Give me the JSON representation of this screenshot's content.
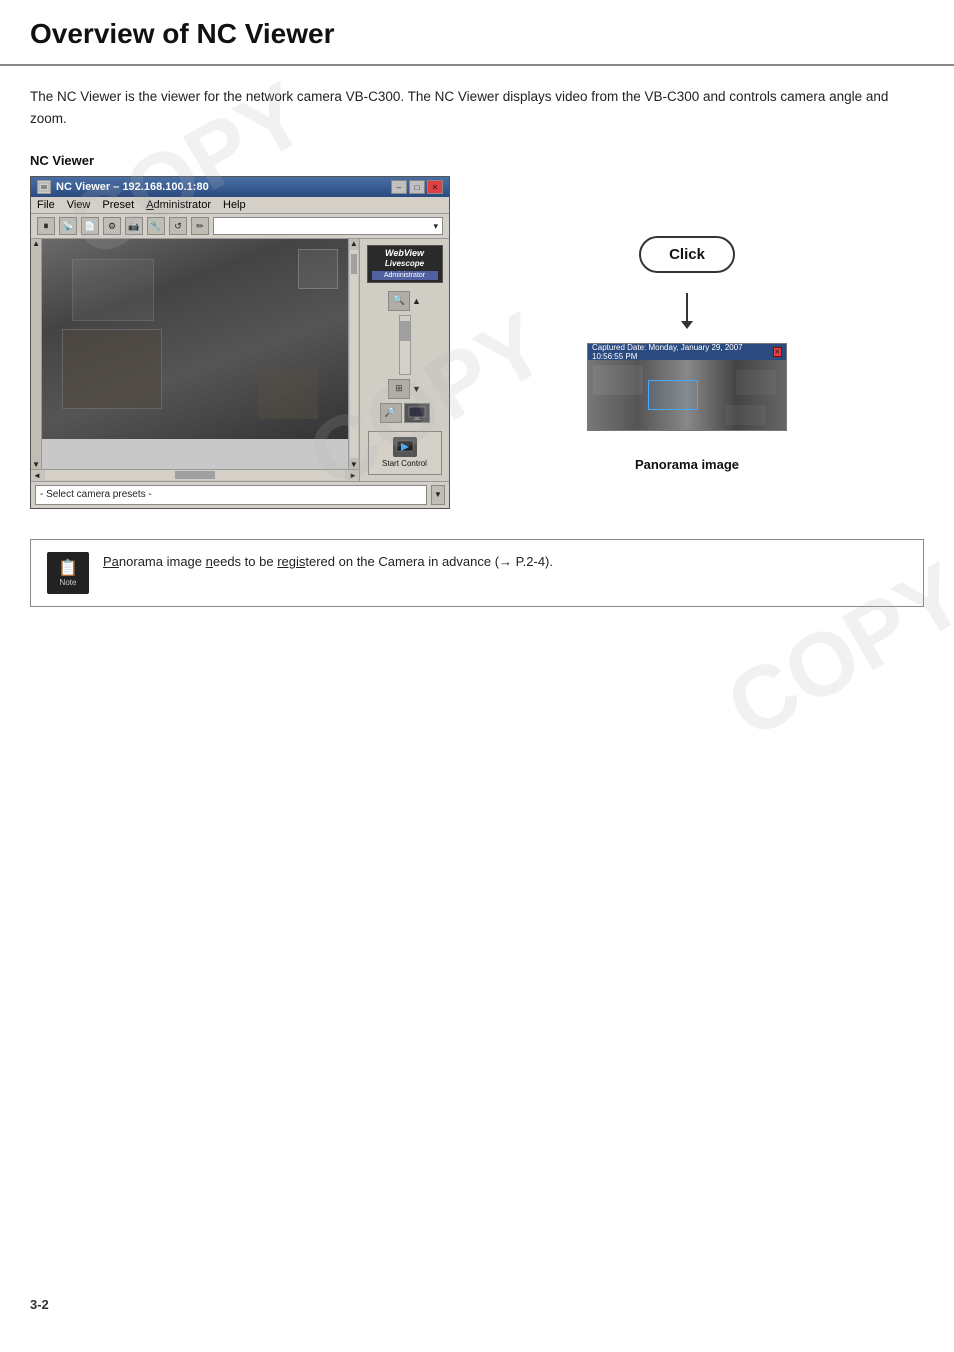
{
  "page": {
    "title": "Overview of NC Viewer",
    "number": "3-2"
  },
  "intro": {
    "text": "The NC Viewer is the viewer for the network camera VB-C300.  The NC Viewer displays video from the VB-C300 and controls camera angle and zoom."
  },
  "section": {
    "label": "NC Viewer"
  },
  "nc_viewer": {
    "titlebar": {
      "icon_alt": "nc-viewer-icon",
      "title": "NC Viewer – 192.168.100.1:80",
      "btn_minimize": "–",
      "btn_maximize": "□",
      "btn_close": "✕"
    },
    "menu": {
      "items": [
        "File",
        "View",
        "Preset",
        "Administrator",
        "Help"
      ]
    },
    "toolbar": {
      "pause_icon": "⏸",
      "icons": [
        "📡",
        "📄",
        "⚙",
        "📷",
        "🔧",
        "↺",
        "✏"
      ]
    },
    "webview": {
      "title_line1": "WebView",
      "title_line2": "Livescope",
      "admin_label": "Administrator"
    },
    "preset_dropdown": {
      "placeholder": "- Select camera presets -",
      "arrow": "▼"
    },
    "start_control": {
      "label": "Start Control"
    }
  },
  "click_label": "Click",
  "panorama": {
    "title_text": "Captured Date: Monday, January 29, 2007 10:56:55 PM",
    "close_btn": "✕",
    "label": "Panorama image"
  },
  "note": {
    "icon_symbol": "📋",
    "icon_label": "Note",
    "text_part1": "Panorama image needs to be registered on the Camera in advance (",
    "arrow": "→",
    "text_part2": " P.2-4)."
  },
  "scrollbar": {
    "up": "▲",
    "down": "▼",
    "left": "◄",
    "right": "►"
  }
}
